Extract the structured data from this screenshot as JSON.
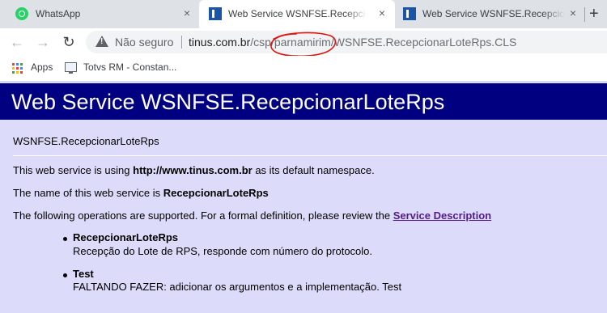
{
  "tabs": [
    {
      "title": "WhatsApp",
      "favicon": "whatsapp-icon",
      "active": false
    },
    {
      "title": "Web Service WSNFSE.Recepcionar",
      "favicon": "document-icon",
      "active": true
    },
    {
      "title": "Web Service WSNFSE.Recepcionar",
      "favicon": "document-icon",
      "active": false
    }
  ],
  "tab_close_glyph": "×",
  "new_tab_glyph": "+",
  "toolbar": {
    "back_glyph": "←",
    "forward_glyph": "→",
    "reload_glyph": "↻",
    "security_label": "Não seguro",
    "url_host": "tinus.com.br",
    "url_path": "/csp/parnamirim/WSNFSE.RecepcionarLoteRps.CLS",
    "annotation_color": "#e0140f"
  },
  "bookmarks": [
    {
      "label": "Apps",
      "icon": "apps-grid-icon"
    },
    {
      "label": "Totvs RM - Constan...",
      "icon": "monitor-icon"
    }
  ],
  "page": {
    "banner_title": "Web Service WSNFSE.RecepcionarLoteRps",
    "service_name": "WSNFSE.RecepcionarLoteRps",
    "namespace_prefix": "This web service is using ",
    "namespace": "http://www.tinus.com.br",
    "namespace_suffix": " as its default namespace.",
    "name_prefix": "The name of this web service is ",
    "name": "RecepcionarLoteRps",
    "ops_prefix": "The following operations are supported. For a formal definition, please review the ",
    "service_description_link": "Service Description",
    "operations": [
      {
        "name": "RecepcionarLoteRps",
        "description": "Recepção do Lote de RPS, responde com número do protocolo."
      },
      {
        "name": "Test",
        "description": "FALTANDO FAZER: adicionar os argumentos e a implementação. Test"
      }
    ]
  },
  "colors": {
    "tabstrip": "#dee1e6",
    "banner": "#000080",
    "page_background": "#dcdcfa",
    "link": "#551a8b"
  }
}
